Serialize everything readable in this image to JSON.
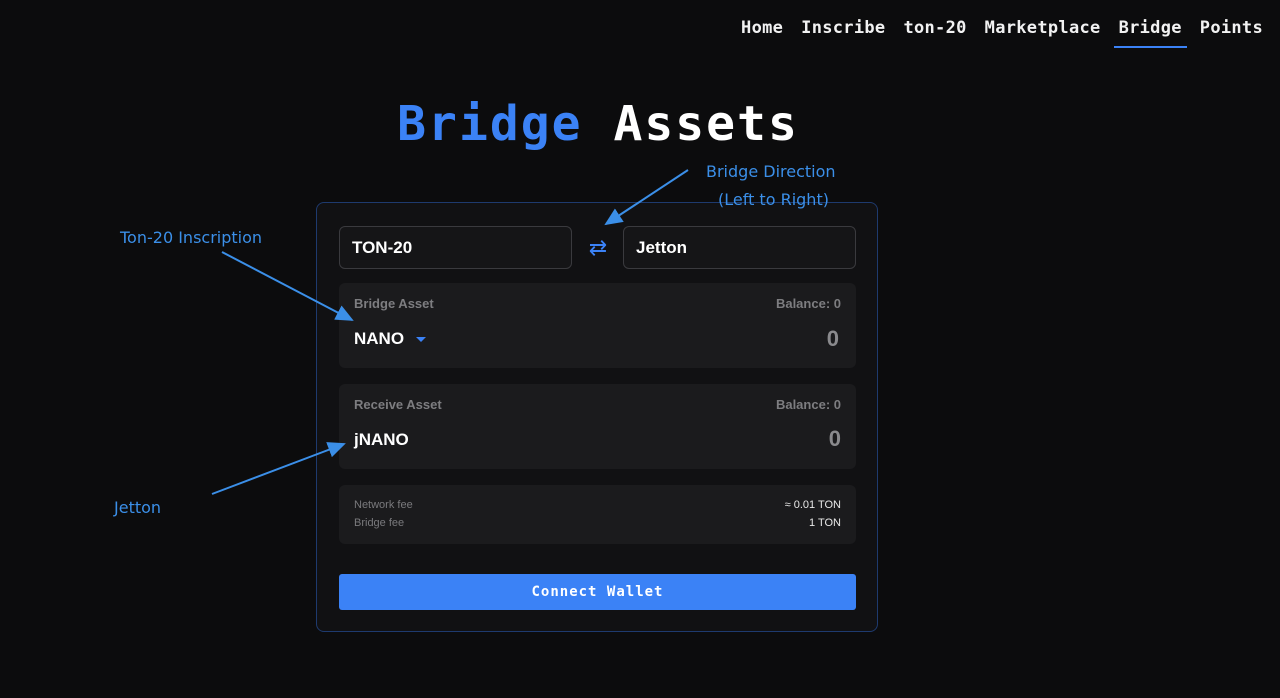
{
  "nav": {
    "items": [
      {
        "label": "Home"
      },
      {
        "label": "Inscribe"
      },
      {
        "label": "ton-20"
      },
      {
        "label": "Marketplace"
      },
      {
        "label": "Bridge"
      },
      {
        "label": "Points"
      }
    ],
    "active": "Bridge"
  },
  "heading": {
    "accent": "Bridge",
    "rest": "Assets"
  },
  "bridge": {
    "from_chain": "TON-20",
    "to_chain": "Jetton",
    "swap_icon": "swap-arrows-icon",
    "send": {
      "label": "Bridge Asset",
      "balance": "Balance: 0",
      "token": "NANO",
      "amount_placeholder": "0"
    },
    "receive": {
      "label": "Receive Asset",
      "balance": "Balance: 0",
      "token": "jNANO",
      "amount": "0"
    },
    "fees": {
      "network_label": "Network fee",
      "network_value": "≈ 0.01 TON",
      "bridge_label": "Bridge fee",
      "bridge_value": "1 TON"
    },
    "connect_label": "Connect Wallet"
  },
  "annotations": {
    "direction_line1": "Bridge Direction",
    "direction_line2": "(Left to Right)",
    "inscription": "Ton-20 Inscription",
    "jetton": "Jetton",
    "color": "#3b8fe8"
  },
  "colors": {
    "accent": "#3b82f6",
    "background": "#0c0c0d",
    "panel": "#1b1b1d"
  }
}
